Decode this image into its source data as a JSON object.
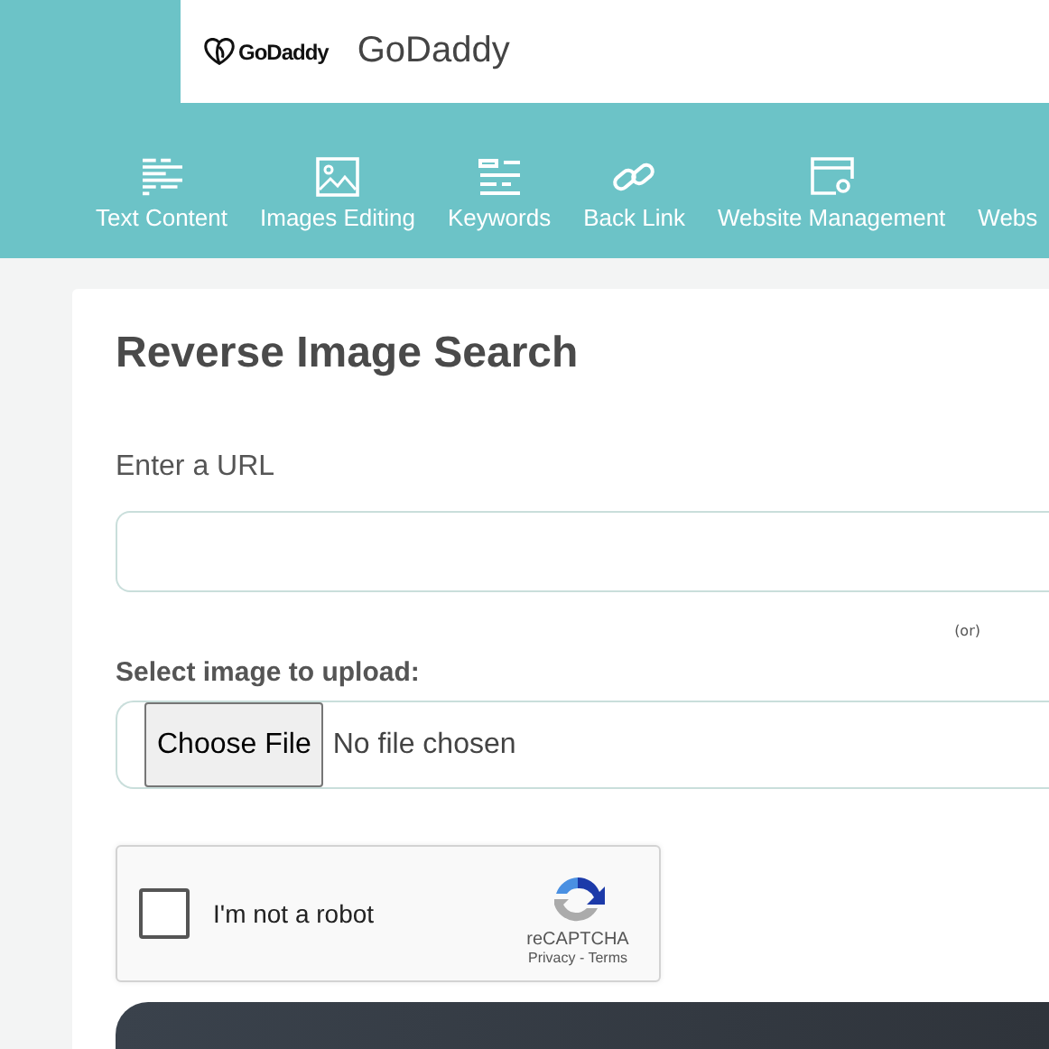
{
  "header": {
    "logo_text": "GoDaddy",
    "site_name": "GoDaddy"
  },
  "nav": [
    {
      "kind": "text",
      "label": "Text Content"
    },
    {
      "kind": "image",
      "label": "Images Editing"
    },
    {
      "kind": "keywords",
      "label": "Keywords"
    },
    {
      "kind": "link",
      "label": "Back Link"
    },
    {
      "kind": "website",
      "label": "Website Management"
    },
    {
      "kind": "none",
      "label": "Webs"
    }
  ],
  "form": {
    "title": "Reverse Image Search",
    "url_label": "Enter a URL",
    "or_text": "(or)",
    "upload_label": "Select image to upload:",
    "file_button": "Choose File",
    "file_status": "No file chosen"
  },
  "captcha": {
    "checked": false,
    "label": "I'm not a robot",
    "brand": "reCAPTCHA",
    "privacy": "Privacy",
    "separator": "-",
    "terms": "Terms"
  }
}
